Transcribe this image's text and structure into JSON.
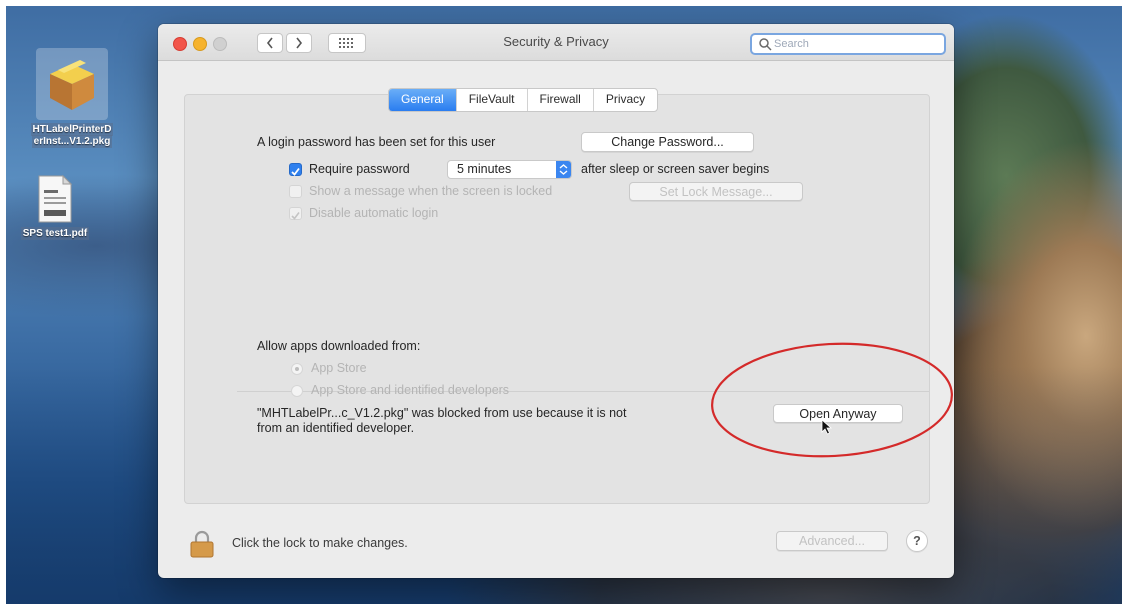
{
  "desktop": {
    "icons": [
      {
        "label_line1": "HTLabelPrinterD",
        "label_line2": "erInst...V1.2.pkg",
        "icon": "package-icon"
      },
      {
        "label_line1": "SPS test1.pdf",
        "icon": "pdf-document-icon"
      }
    ]
  },
  "window": {
    "title": "Security & Privacy",
    "search_placeholder": "Search",
    "tabs": [
      {
        "label": "General",
        "selected": true
      },
      {
        "label": "FileVault",
        "selected": false
      },
      {
        "label": "Firewall",
        "selected": false
      },
      {
        "label": "Privacy",
        "selected": false
      }
    ],
    "general": {
      "login_password_text": "A login password has been set for this user",
      "change_password_label": "Change Password...",
      "require_password_label": "Require password",
      "require_password_checked": true,
      "require_password_delay": "5 minutes",
      "after_sleep_text": "after sleep or screen saver begins",
      "show_message_label": "Show a message when the screen is locked",
      "show_message_checked": false,
      "set_lock_message_label": "Set Lock Message...",
      "disable_auto_login_label": "Disable automatic login",
      "disable_auto_login_checked": true,
      "allow_apps_heading": "Allow apps downloaded from:",
      "allow_options": [
        {
          "label": "App Store",
          "selected": true
        },
        {
          "label": "App Store and identified developers",
          "selected": false
        }
      ],
      "blocked_line1": "\"MHTLabelPr...c_V1.2.pkg\" was blocked from use because it is not",
      "blocked_line2": "from an identified developer.",
      "open_anyway_label": "Open Anyway"
    },
    "footer": {
      "lock_text": "Click the lock to make changes.",
      "advanced_label": "Advanced...",
      "help_label": "?"
    }
  },
  "colors": {
    "accent": "#2f80ee",
    "annotation_circle": "#d42a2a"
  }
}
